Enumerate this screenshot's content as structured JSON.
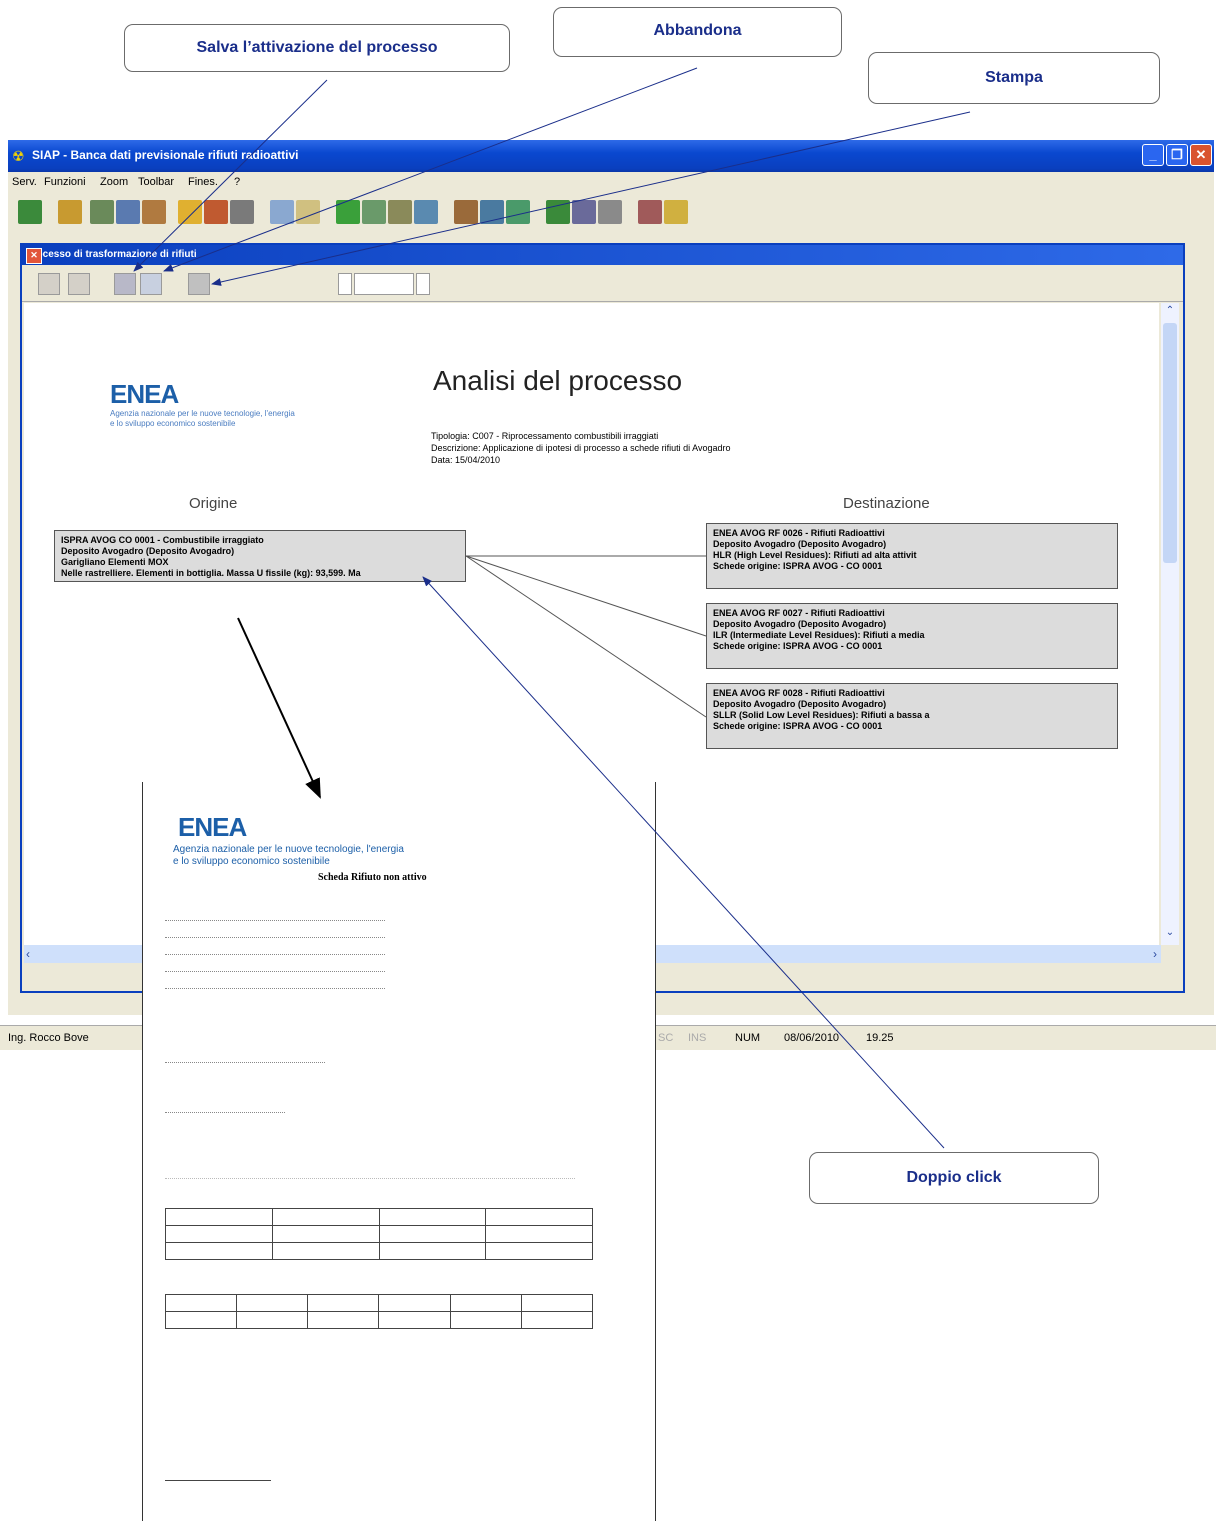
{
  "callouts": {
    "save": "Salva l’attivazione del processo",
    "abandon": "Abbandona",
    "print": "Stampa",
    "double_click": "Doppio click"
  },
  "app": {
    "title": "SIAP - Banca dati previsionale rifiuti radioattivi",
    "menu": [
      "Serv.",
      "Funzioni",
      "Zoom",
      "Toolbar",
      "Fines.",
      "?"
    ]
  },
  "child": {
    "title": "Processo di trasformazione di rifiuti"
  },
  "report": {
    "logo": "ENEA",
    "agency_line1": "Agenzia nazionale per le nuove tecnologie, l'energia",
    "agency_line2": "e lo sviluppo economico sostenibile",
    "heading": "Analisi del processo",
    "tipologia": "Tipologia: C007 - Riprocessamento combustibili irraggiati",
    "descrizione": "Descrizione: Applicazione di ipotesi di processo a schede rifiuti di Avogadro",
    "data": "Data: 15/04/2010",
    "origin_label": "Origine",
    "dest_label": "Destinazione",
    "origin_box": [
      "ISPRA AVOG CO 0001 - Combustibile irraggiato",
      "Deposito Avogadro (Deposito Avogadro)",
      "Garigliano Elementi MOX",
      "Nelle rastrelliere. Elementi in bottiglia. Massa U fissile (kg): 93,599. Ma"
    ],
    "dest_boxes": [
      [
        "ENEA AVOG RF 0026 - Rifiuti Radioattivi",
        "Deposito Avogadro (Deposito Avogadro)",
        "HLR (High Level Residues): Rifiuti ad alta attivit",
        "Schede origine: ISPRA AVOG - CO 0001"
      ],
      [
        "ENEA AVOG RF 0027 - Rifiuti Radioattivi",
        "Deposito Avogadro (Deposito Avogadro)",
        "ILR (Intermediate Level Residues): Rifiuti a media",
        "Schede origine: ISPRA AVOG - CO 0001"
      ],
      [
        "ENEA AVOG RF 0028 - Rifiuti Radioattivi",
        "Deposito Avogadro (Deposito Avogadro)",
        "SLLR (Solid Low Level Residues): Rifiuti a bassa a",
        "Schede origine: ISPRA AVOG - CO 0001"
      ]
    ]
  },
  "status": {
    "user": "Ing. Rocco Bove",
    "num": "NUM",
    "date": "08/06/2010",
    "time": "19.25",
    "ind1": "SC",
    "ind2": "INS"
  },
  "paper": {
    "logo": "ENEA",
    "agency_line1": "Agenzia nazionale per le nuove tecnologie, l'energia",
    "agency_line2": "e lo sviluppo economico sostenibile",
    "title": "Scheda Rifiuto non attivo"
  }
}
